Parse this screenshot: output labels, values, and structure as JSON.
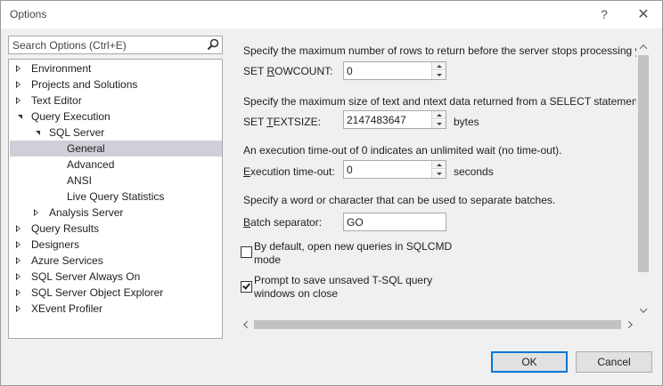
{
  "window": {
    "title": "Options",
    "help_glyph": "?",
    "close_glyph": "✕"
  },
  "search": {
    "placeholder": "Search Options (Ctrl+E)"
  },
  "tree": [
    {
      "label": "Environment",
      "expander": "collapsed",
      "level": 0
    },
    {
      "label": "Projects and Solutions",
      "expander": "collapsed",
      "level": 0
    },
    {
      "label": "Text Editor",
      "expander": "collapsed",
      "level": 0
    },
    {
      "label": "Query Execution",
      "expander": "expanded",
      "level": 0
    },
    {
      "label": "SQL Server",
      "expander": "expanded",
      "level": 1
    },
    {
      "label": "General",
      "expander": "none",
      "level": 2,
      "selected": true
    },
    {
      "label": "Advanced",
      "expander": "none",
      "level": 2
    },
    {
      "label": "ANSI",
      "expander": "none",
      "level": 2
    },
    {
      "label": "Live Query Statistics",
      "expander": "none",
      "level": 2
    },
    {
      "label": "Analysis Server",
      "expander": "collapsed",
      "level": 1
    },
    {
      "label": "Query Results",
      "expander": "collapsed",
      "level": 0
    },
    {
      "label": "Designers",
      "expander": "collapsed",
      "level": 0
    },
    {
      "label": "Azure Services",
      "expander": "collapsed",
      "level": 0
    },
    {
      "label": "SQL Server Always On",
      "expander": "collapsed",
      "level": 0
    },
    {
      "label": "SQL Server Object Explorer",
      "expander": "collapsed",
      "level": 0
    },
    {
      "label": "XEvent Profiler",
      "expander": "collapsed",
      "level": 0
    }
  ],
  "settings": {
    "rowcount_desc": "Specify the maximum number of rows to return before the server stops processing y",
    "rowcount_label_pre": "SET ",
    "rowcount_label_accel": "R",
    "rowcount_label_post": "OWCOUNT:",
    "rowcount_value": "0",
    "textsize_desc": "Specify the maximum size of text and ntext data returned from a SELECT statement.",
    "textsize_label_pre": "SET ",
    "textsize_label_accel": "T",
    "textsize_label_post": "EXTSIZE:",
    "textsize_value": "2147483647",
    "textsize_unit": "bytes",
    "timeout_desc": "An execution time-out of 0 indicates an unlimited wait (no time-out).",
    "timeout_label_accel": "E",
    "timeout_label_post": "xecution time-out:",
    "timeout_value": "0",
    "timeout_unit": "seconds",
    "batch_desc": "Specify a word or character that can be used to separate batches.",
    "batch_label_accel": "B",
    "batch_label_post": "atch separator:",
    "batch_value": "GO",
    "sqlcmd_line1": "By default, open new queries in SQLCMD",
    "sqlcmd_line2": "mode",
    "sqlcmd_checked": false,
    "prompt_line1": "Prompt to save unsaved T-SQL query",
    "prompt_line2": "windows on close",
    "prompt_checked": true
  },
  "buttons": {
    "ok": "OK",
    "cancel": "Cancel"
  }
}
